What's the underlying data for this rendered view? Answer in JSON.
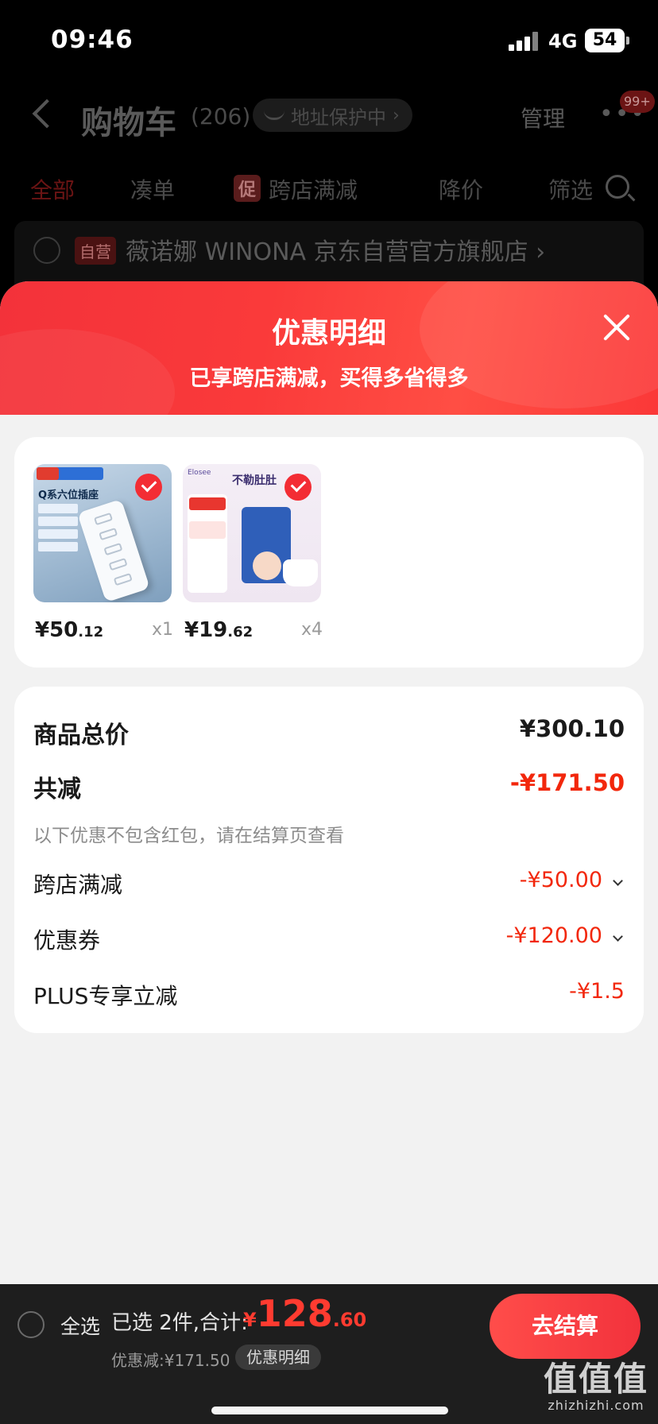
{
  "status_bar": {
    "time": "09:46",
    "network": "4G",
    "battery": "54"
  },
  "nav": {
    "title": "购物车",
    "count": "(206)",
    "address_protect": "地址保护中",
    "manage": "管理",
    "more": "•••",
    "badge": "99+"
  },
  "tabs": {
    "all": "全部",
    "bundle": "凑单",
    "promo_tag": "促",
    "cross_store": "跨店满减",
    "price_drop": "降价",
    "filter": "筛选"
  },
  "store": {
    "self_tag": "自营",
    "name": "薇诺娜 WINONA 京东自营官方旗舰店",
    "chevron": "›"
  },
  "sheet": {
    "title": "优惠明细",
    "subtitle": "已享跨店满减，买得多省得多"
  },
  "products": [
    {
      "price_int": "¥50",
      "price_dec": ".12",
      "qty": "x1",
      "image_text": "Q系六位插座"
    },
    {
      "price_int": "¥19",
      "price_dec": ".62",
      "qty": "x4",
      "image_text": "不勒肚肚"
    }
  ],
  "summary": {
    "total_label": "商品总价",
    "total_value": "¥300.10",
    "reduce_label": "共减",
    "reduce_value": "-¥171.50",
    "note": "以下优惠不包含红包，请在结算页查看",
    "items": [
      {
        "label": "跨店满减",
        "value": "-¥50.00",
        "expandable": true
      },
      {
        "label": "优惠券",
        "value": "-¥120.00",
        "expandable": true
      },
      {
        "label": "PLUS专享立减",
        "value": "-¥1.5",
        "expandable": false
      }
    ]
  },
  "checkout": {
    "select_all": "全选",
    "selected_text": "已选 2件,合计:",
    "total_symbol": "¥",
    "total_int": "128",
    "total_dec": ".60",
    "discount": "优惠减:¥171.50",
    "detail_link": "优惠明细",
    "button": "去结算"
  },
  "watermark": {
    "main": "值值值",
    "sub": "zhizhizhi.com"
  },
  "colors": {
    "accent_red": "#f2270c",
    "header_red": "#fa3a3a",
    "checkout_btn": "#ff4d4a"
  }
}
